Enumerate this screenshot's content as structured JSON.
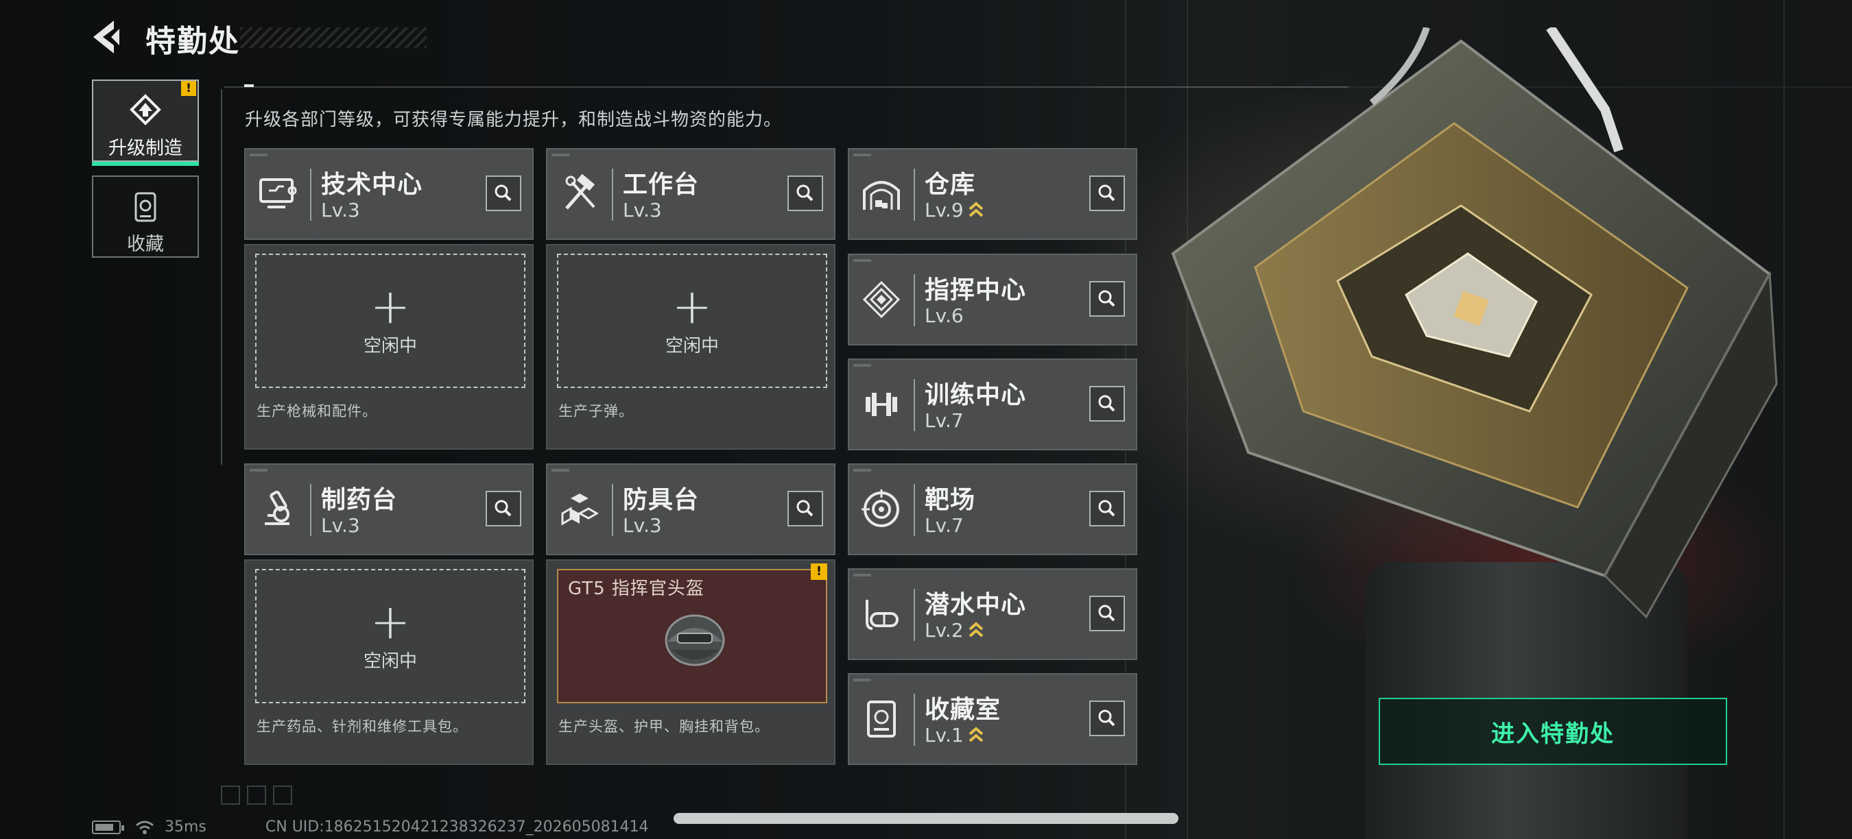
{
  "header": {
    "title": "特勤处",
    "back_icon": "back-arrow-icon"
  },
  "tabs": [
    {
      "label": "升级制造",
      "icon": "upgrade-craft-icon",
      "selected": true,
      "badge": "!"
    },
    {
      "label": "收藏",
      "icon": "collection-icon",
      "selected": false
    }
  ],
  "description": "升级各部门等级，可获得专属能力提升，和制造战斗物资的能力。",
  "craft_departments": [
    {
      "name": "技术中心",
      "level": "Lv.3",
      "icon": "tech-center-icon",
      "slot_status": "空闲中",
      "slot_desc": "生产枪械和配件。"
    },
    {
      "name": "工作台",
      "level": "Lv.3",
      "icon": "workbench-icon",
      "slot_status": "空闲中",
      "slot_desc": "生产子弹。"
    },
    {
      "name": "制药台",
      "level": "Lv.3",
      "icon": "pharmacy-icon",
      "slot_status": "空闲中",
      "slot_desc": "生产药品、针剂和维修工具包。"
    },
    {
      "name": "防具台",
      "level": "Lv.3",
      "icon": "armor-bench-icon",
      "slot_desc": "生产头盔、护甲、胸挂和背包。",
      "crafting": {
        "item_name": "GT5 指挥官头盔",
        "badge": "!",
        "item_icon": "helmet-icon"
      }
    }
  ],
  "other_departments": [
    {
      "name": "仓库",
      "level": "Lv.9",
      "icon": "warehouse-icon",
      "upgradable": true
    },
    {
      "name": "指挥中心",
      "level": "Lv.6",
      "icon": "command-center-icon",
      "upgradable": false
    },
    {
      "name": "训练中心",
      "level": "Lv.7",
      "icon": "training-center-icon",
      "upgradable": false
    },
    {
      "name": "靶场",
      "level": "Lv.7",
      "icon": "shooting-range-icon",
      "upgradable": false
    },
    {
      "name": "潜水中心",
      "level": "Lv.2",
      "icon": "diving-center-icon",
      "upgradable": true
    },
    {
      "name": "收藏室",
      "level": "Lv.1",
      "icon": "collection-room-icon",
      "upgradable": true
    }
  ],
  "enter_button": "进入特勤处",
  "footer": {
    "latency": "35ms",
    "uid": "CN UID:1862515204212383262​37_202605081414"
  },
  "colors": {
    "accent": "#3ef0a8",
    "badge": "#f2b800",
    "card": "#4a4c4d",
    "craft_bg": "#4b2a2c"
  }
}
